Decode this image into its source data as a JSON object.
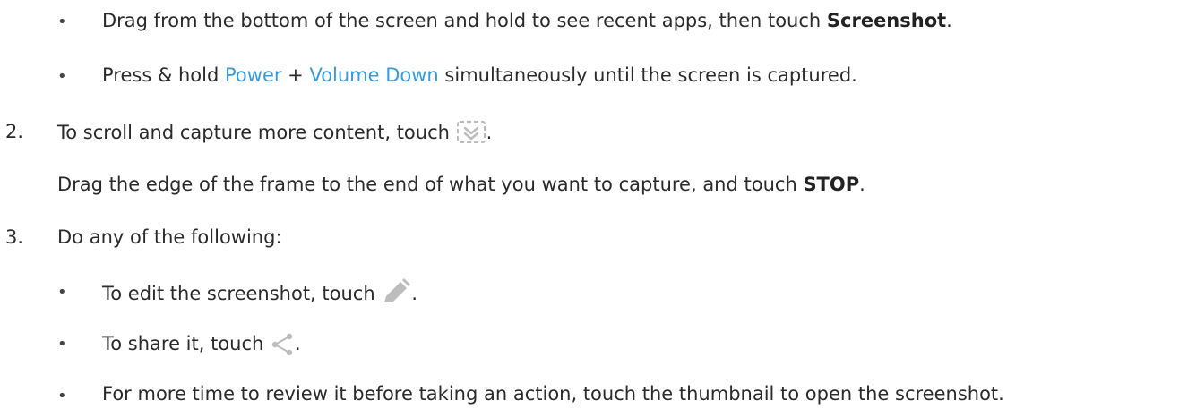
{
  "steps": {
    "bullet_char": "•",
    "step1_bullets": {
      "b1_pre": "Drag from the bottom of the screen and hold to see recent apps, then touch ",
      "b1_bold": "Screenshot",
      "b1_post": ".",
      "b2_pre": "Press & hold ",
      "b2_link1": "Power",
      "b2_mid": " + ",
      "b2_link2": "Volume Down",
      "b2_post": " simultaneously until the screen is captured."
    },
    "step2": {
      "number": "2.",
      "text_pre": "To scroll and capture more content, touch ",
      "text_post": ".",
      "para_pre": "Drag the edge of the frame to the end of what you want to capture, and touch ",
      "para_bold": "STOP",
      "para_post": ".",
      "icon": "scroll-capture-icon"
    },
    "step3": {
      "number": "3.",
      "text": "Do any of the following:",
      "b1_pre": "To edit the screenshot, touch ",
      "b1_post": ".",
      "b1_icon": "pencil-edit-icon",
      "b2_pre": "To share it, touch ",
      "b2_post": ".",
      "b2_icon": "share-icon",
      "b3": "For more time to review it before taking an action, touch the thumbnail to open the screenshot."
    }
  },
  "colors": {
    "text": "#2b2b2b",
    "link": "#3a9bdc",
    "icon": "#bdbdbd"
  }
}
